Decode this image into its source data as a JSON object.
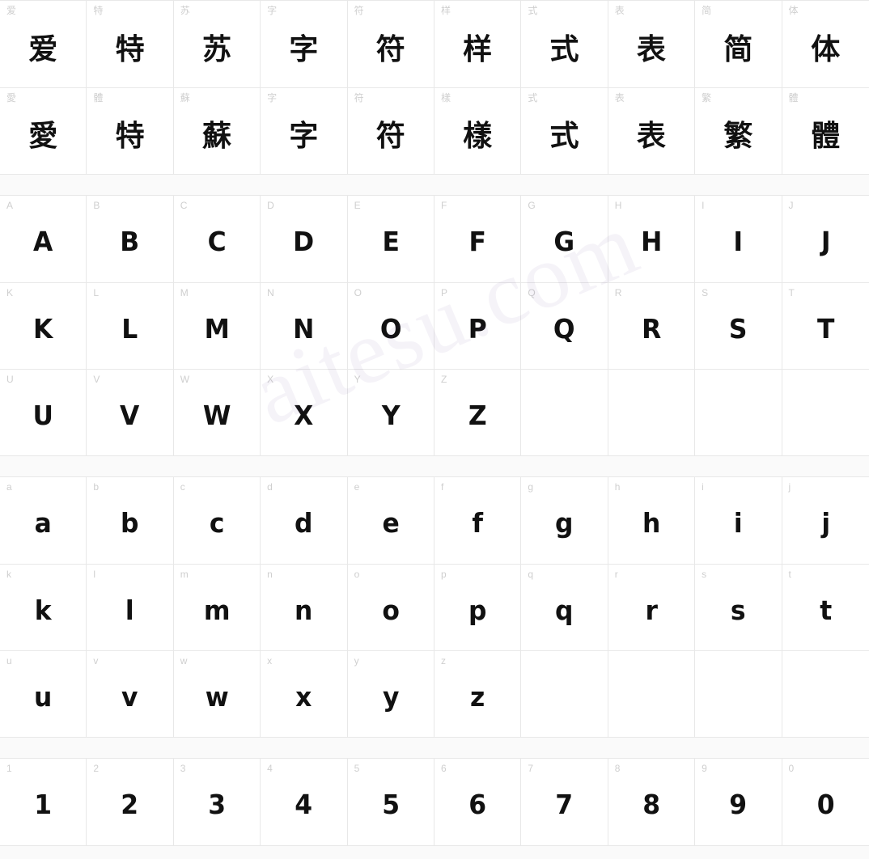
{
  "watermark": "aitesu.com",
  "blocks": [
    {
      "name": "cjk-sample-block",
      "rows": [
        {
          "cells": [
            {
              "label": "爱",
              "glyph": "爱",
              "type": "cjk"
            },
            {
              "label": "特",
              "glyph": "特",
              "type": "cjk"
            },
            {
              "label": "苏",
              "glyph": "苏",
              "type": "cjk"
            },
            {
              "label": "字",
              "glyph": "字",
              "type": "cjk"
            },
            {
              "label": "符",
              "glyph": "符",
              "type": "cjk"
            },
            {
              "label": "样",
              "glyph": "样",
              "type": "cjk"
            },
            {
              "label": "式",
              "glyph": "式",
              "type": "cjk"
            },
            {
              "label": "表",
              "glyph": "表",
              "type": "cjk"
            },
            {
              "label": "简",
              "glyph": "简",
              "type": "cjk"
            },
            {
              "label": "体",
              "glyph": "体",
              "type": "cjk"
            }
          ]
        },
        {
          "cells": [
            {
              "label": "愛",
              "glyph": "愛",
              "type": "cjk"
            },
            {
              "label": "體",
              "glyph": "特",
              "type": "cjk"
            },
            {
              "label": "蘇",
              "glyph": "蘇",
              "type": "cjk"
            },
            {
              "label": "字",
              "glyph": "字",
              "type": "cjk"
            },
            {
              "label": "符",
              "glyph": "符",
              "type": "cjk"
            },
            {
              "label": "樣",
              "glyph": "樣",
              "type": "cjk"
            },
            {
              "label": "式",
              "glyph": "式",
              "type": "cjk"
            },
            {
              "label": "表",
              "glyph": "表",
              "type": "cjk"
            },
            {
              "label": "繁",
              "glyph": "繁",
              "type": "cjk"
            },
            {
              "label": "體",
              "glyph": "體",
              "type": "cjk"
            }
          ]
        }
      ]
    },
    {
      "name": "uppercase-block",
      "rows": [
        {
          "cells": [
            {
              "label": "A",
              "glyph": "A",
              "type": "latin"
            },
            {
              "label": "B",
              "glyph": "B",
              "type": "latin"
            },
            {
              "label": "C",
              "glyph": "C",
              "type": "latin"
            },
            {
              "label": "D",
              "glyph": "D",
              "type": "latin"
            },
            {
              "label": "E",
              "glyph": "E",
              "type": "latin"
            },
            {
              "label": "F",
              "glyph": "F",
              "type": "latin"
            },
            {
              "label": "G",
              "glyph": "G",
              "type": "latin"
            },
            {
              "label": "H",
              "glyph": "H",
              "type": "latin"
            },
            {
              "label": "I",
              "glyph": "I",
              "type": "latin"
            },
            {
              "label": "J",
              "glyph": "J",
              "type": "latin"
            }
          ]
        },
        {
          "cells": [
            {
              "label": "K",
              "glyph": "K",
              "type": "latin"
            },
            {
              "label": "L",
              "glyph": "L",
              "type": "latin"
            },
            {
              "label": "M",
              "glyph": "M",
              "type": "latin"
            },
            {
              "label": "N",
              "glyph": "N",
              "type": "latin"
            },
            {
              "label": "O",
              "glyph": "O",
              "type": "latin"
            },
            {
              "label": "P",
              "glyph": "P",
              "type": "latin"
            },
            {
              "label": "Q",
              "glyph": "Q",
              "type": "latin"
            },
            {
              "label": "R",
              "glyph": "R",
              "type": "latin"
            },
            {
              "label": "S",
              "glyph": "S",
              "type": "latin"
            },
            {
              "label": "T",
              "glyph": "T",
              "type": "latin"
            }
          ]
        },
        {
          "cells": [
            {
              "label": "U",
              "glyph": "U",
              "type": "latin"
            },
            {
              "label": "V",
              "glyph": "V",
              "type": "latin"
            },
            {
              "label": "W",
              "glyph": "W",
              "type": "latin"
            },
            {
              "label": "X",
              "glyph": "X",
              "type": "latin"
            },
            {
              "label": "Y",
              "glyph": "Y",
              "type": "latin"
            },
            {
              "label": "Z",
              "glyph": "Z",
              "type": "latin"
            },
            {
              "label": "",
              "glyph": "",
              "type": "empty"
            },
            {
              "label": "",
              "glyph": "",
              "type": "empty"
            },
            {
              "label": "",
              "glyph": "",
              "type": "empty"
            },
            {
              "label": "",
              "glyph": "",
              "type": "empty"
            }
          ]
        }
      ]
    },
    {
      "name": "lowercase-block",
      "rows": [
        {
          "cells": [
            {
              "label": "a",
              "glyph": "a",
              "type": "latin"
            },
            {
              "label": "b",
              "glyph": "b",
              "type": "latin"
            },
            {
              "label": "c",
              "glyph": "c",
              "type": "latin"
            },
            {
              "label": "d",
              "glyph": "d",
              "type": "latin"
            },
            {
              "label": "e",
              "glyph": "e",
              "type": "latin"
            },
            {
              "label": "f",
              "glyph": "f",
              "type": "latin"
            },
            {
              "label": "g",
              "glyph": "g",
              "type": "latin"
            },
            {
              "label": "h",
              "glyph": "h",
              "type": "latin"
            },
            {
              "label": "i",
              "glyph": "i",
              "type": "latin"
            },
            {
              "label": "j",
              "glyph": "j",
              "type": "latin"
            }
          ]
        },
        {
          "cells": [
            {
              "label": "k",
              "glyph": "k",
              "type": "latin"
            },
            {
              "label": "l",
              "glyph": "l",
              "type": "latin"
            },
            {
              "label": "m",
              "glyph": "m",
              "type": "latin"
            },
            {
              "label": "n",
              "glyph": "n",
              "type": "latin"
            },
            {
              "label": "o",
              "glyph": "o",
              "type": "latin"
            },
            {
              "label": "p",
              "glyph": "p",
              "type": "latin"
            },
            {
              "label": "q",
              "glyph": "q",
              "type": "latin"
            },
            {
              "label": "r",
              "glyph": "r",
              "type": "latin"
            },
            {
              "label": "s",
              "glyph": "s",
              "type": "latin"
            },
            {
              "label": "t",
              "glyph": "t",
              "type": "latin"
            }
          ]
        },
        {
          "cells": [
            {
              "label": "u",
              "glyph": "u",
              "type": "latin"
            },
            {
              "label": "v",
              "glyph": "v",
              "type": "latin"
            },
            {
              "label": "w",
              "glyph": "w",
              "type": "latin"
            },
            {
              "label": "x",
              "glyph": "x",
              "type": "latin"
            },
            {
              "label": "y",
              "glyph": "y",
              "type": "latin"
            },
            {
              "label": "z",
              "glyph": "z",
              "type": "latin"
            },
            {
              "label": "",
              "glyph": "",
              "type": "empty"
            },
            {
              "label": "",
              "glyph": "",
              "type": "empty"
            },
            {
              "label": "",
              "glyph": "",
              "type": "empty"
            },
            {
              "label": "",
              "glyph": "",
              "type": "empty"
            }
          ]
        }
      ]
    },
    {
      "name": "digits-block",
      "rows": [
        {
          "cells": [
            {
              "label": "1",
              "glyph": "1",
              "type": "latin"
            },
            {
              "label": "2",
              "glyph": "2",
              "type": "latin"
            },
            {
              "label": "3",
              "glyph": "3",
              "type": "latin"
            },
            {
              "label": "4",
              "glyph": "4",
              "type": "latin"
            },
            {
              "label": "5",
              "glyph": "5",
              "type": "latin"
            },
            {
              "label": "6",
              "glyph": "6",
              "type": "latin"
            },
            {
              "label": "7",
              "glyph": "7",
              "type": "latin"
            },
            {
              "label": "8",
              "glyph": "8",
              "type": "latin"
            },
            {
              "label": "9",
              "glyph": "9",
              "type": "latin"
            },
            {
              "label": "0",
              "glyph": "0",
              "type": "latin"
            }
          ]
        }
      ]
    }
  ]
}
